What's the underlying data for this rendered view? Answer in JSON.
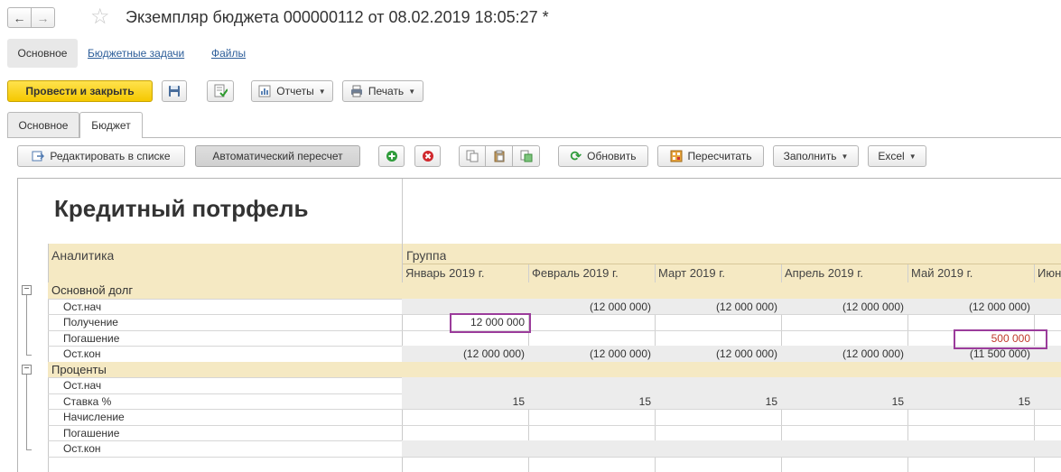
{
  "window": {
    "title": "Экземпляр бюджета 000000112 от 08.02.2019 18:05:27 *",
    "back_icon": "arrow-left-icon",
    "forward_icon": "arrow-right-icon",
    "favorite_icon": "star-icon"
  },
  "sections": {
    "active": "Основное",
    "links": [
      "Бюджетные задачи",
      "Файлы"
    ]
  },
  "toolbar": {
    "post_close": "Провести и закрыть",
    "reports": "Отчеты",
    "print": "Печать"
  },
  "tabs": [
    "Основное",
    "Бюджет"
  ],
  "budget_toolbar": {
    "edit_list": "Редактировать в списке",
    "auto_recalc": "Автоматический пересчет",
    "refresh": "Обновить",
    "recalc": "Пересчитать",
    "fill": "Заполнить",
    "excel": "Excel"
  },
  "sheet": {
    "report_title": "Кредитный потрфель",
    "analytics_header": "Аналитика",
    "group_header": "Группа",
    "months": [
      "Январь 2019 г.",
      "Февраль 2019 г.",
      "Март 2019 г.",
      "Апрель 2019 г.",
      "Май 2019 г.",
      "Июн"
    ],
    "groups": [
      {
        "name": "Основной долг",
        "rows": [
          {
            "label": "Ост.нач",
            "values": [
              "",
              "(12 000 000)",
              "(12 000 000)",
              "(12 000 000)",
              "(12 000 000)",
              ""
            ]
          },
          {
            "label": "Получение",
            "values": [
              "12 000 000",
              "",
              "",
              "",
              "",
              ""
            ]
          },
          {
            "label": "Погашение",
            "values": [
              "",
              "",
              "",
              "",
              "500 000",
              ""
            ]
          },
          {
            "label": "Ост.кон",
            "values": [
              "(12 000 000)",
              "(12 000 000)",
              "(12 000 000)",
              "(12 000 000)",
              "(11 500 000)",
              ""
            ]
          }
        ]
      },
      {
        "name": "Проценты",
        "rows": [
          {
            "label": "Ост.нач",
            "values": [
              "",
              "",
              "",
              "",
              "",
              ""
            ]
          },
          {
            "label": "Ставка %",
            "values": [
              "15",
              "15",
              "15",
              "15",
              "15",
              ""
            ]
          },
          {
            "label": "Начисление",
            "values": [
              "",
              "",
              "",
              "",
              "",
              ""
            ]
          },
          {
            "label": "Погашение",
            "values": [
              "",
              "",
              "",
              "",
              "",
              ""
            ]
          },
          {
            "label": "Ост.кон",
            "values": [
              "",
              "",
              "",
              "",
              "",
              ""
            ]
          }
        ]
      }
    ],
    "collapse_symbol": "−"
  },
  "colors": {
    "header_bg": "#f5e9c3",
    "highlight_border": "#9b3c9b",
    "edited_value": "#c0392b",
    "primary_button": "#f5c800"
  }
}
